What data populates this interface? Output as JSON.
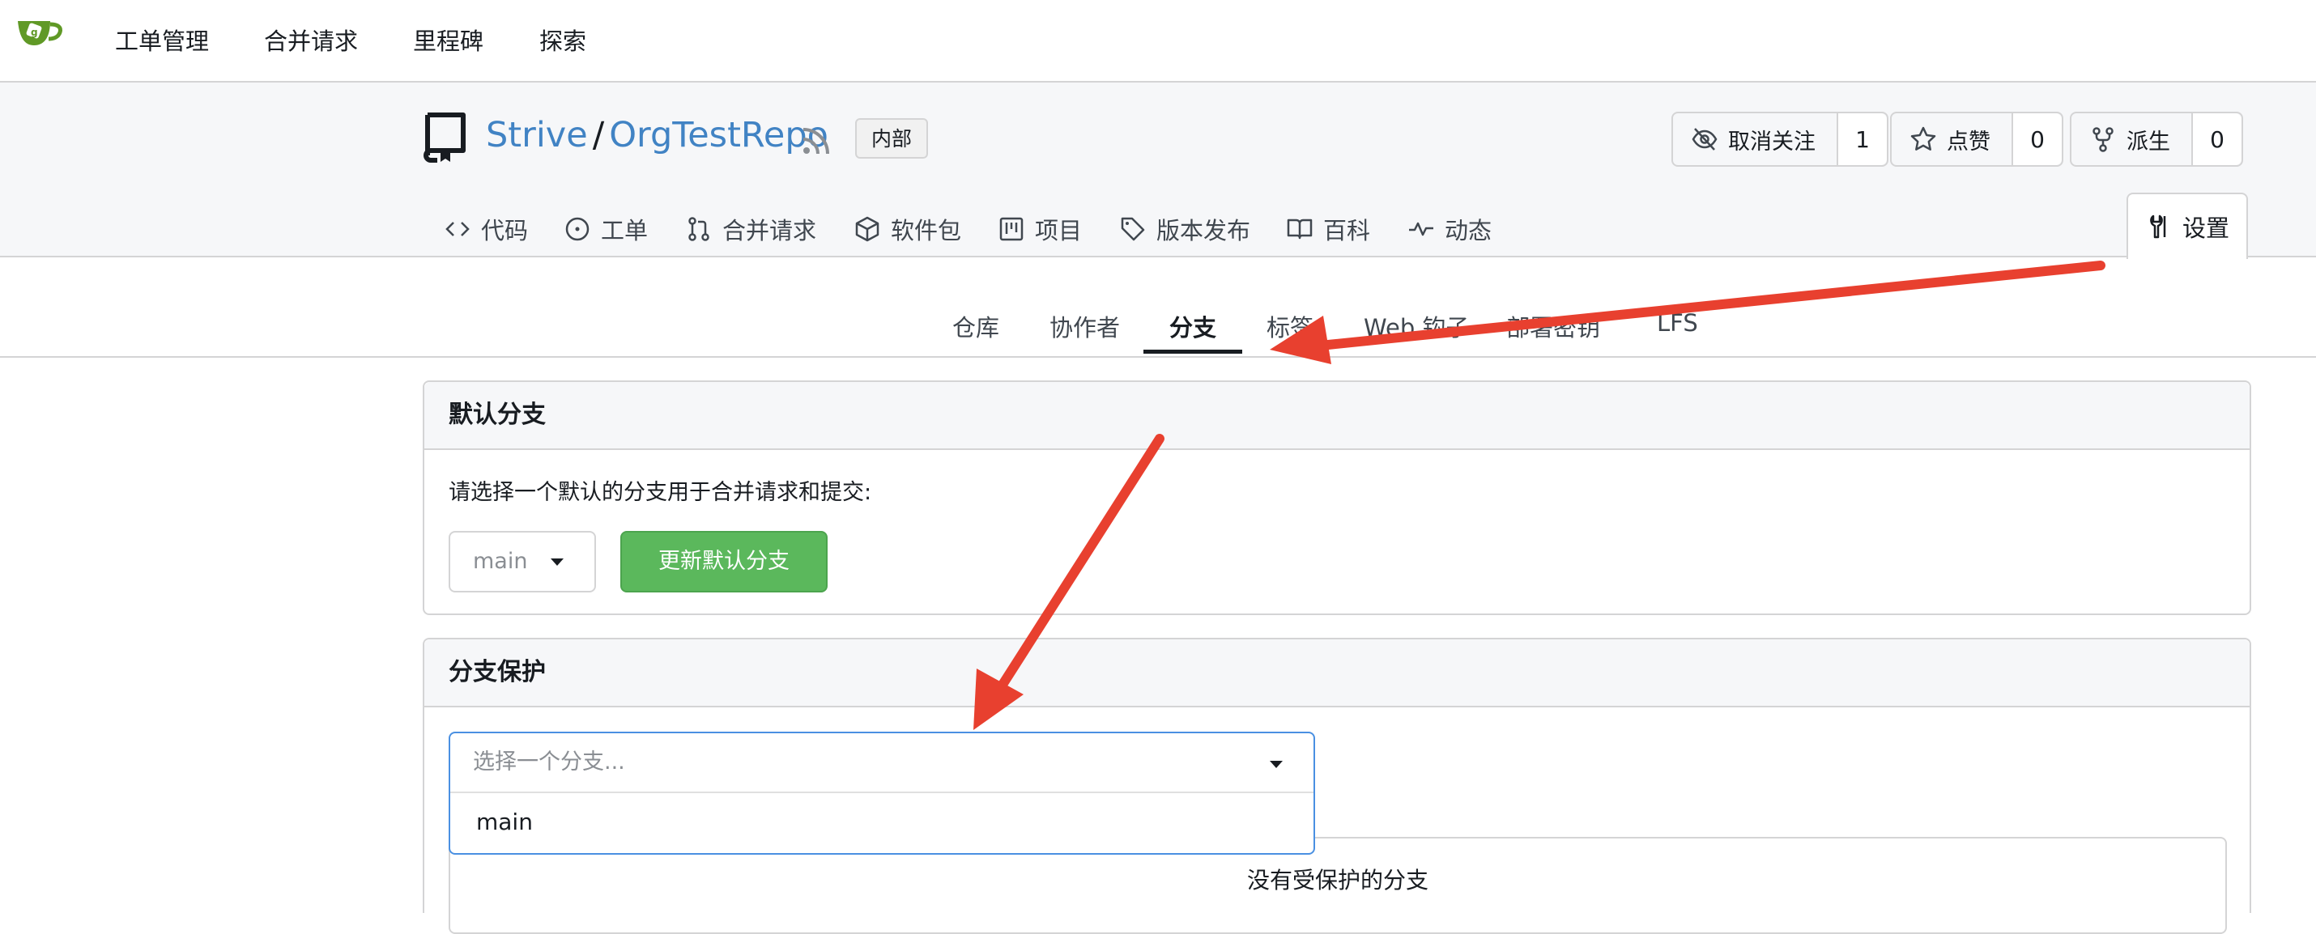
{
  "topnav": {
    "items": [
      "工单管理",
      "合并请求",
      "里程碑",
      "探索"
    ]
  },
  "repo": {
    "owner": "Strive",
    "separator": "/",
    "name": "OrgTestRepo",
    "visibility_badge": "内部",
    "watch": {
      "label": "取消关注",
      "count": "1",
      "icon": "eye-slash-icon"
    },
    "star": {
      "label": "点赞",
      "count": "0",
      "icon": "star-icon"
    },
    "fork": {
      "label": "派生",
      "count": "0",
      "icon": "fork-icon"
    },
    "tabs": [
      {
        "label": "代码",
        "icon": "code-icon"
      },
      {
        "label": "工单",
        "icon": "issue-icon"
      },
      {
        "label": "合并请求",
        "icon": "pull-request-icon"
      },
      {
        "label": "软件包",
        "icon": "package-icon"
      },
      {
        "label": "项目",
        "icon": "project-icon"
      },
      {
        "label": "版本发布",
        "icon": "tag-icon"
      },
      {
        "label": "百科",
        "icon": "book-icon"
      },
      {
        "label": "动态",
        "icon": "pulse-icon"
      }
    ],
    "settings_tab": {
      "label": "设置",
      "icon": "tools-icon"
    }
  },
  "settings_menu": {
    "items": [
      "仓库",
      "协作者",
      "分支",
      "标签",
      "Web 钩子",
      "部署密钥",
      "LFS"
    ],
    "active": "分支"
  },
  "default_branch": {
    "header": "默认分支",
    "description": "请选择一个默认的分支用于合并请求和提交:",
    "selected": "main",
    "update_button": "更新默认分支"
  },
  "branch_protection": {
    "header": "分支保护",
    "select_placeholder": "选择一个分支...",
    "options": [
      "main"
    ],
    "empty_message": "没有受保护的分支"
  },
  "colors": {
    "link": "#4183c4",
    "primary_green": "#5bb85c",
    "annotation_arrow": "#e8402f",
    "focus_border": "#4a90e2"
  }
}
